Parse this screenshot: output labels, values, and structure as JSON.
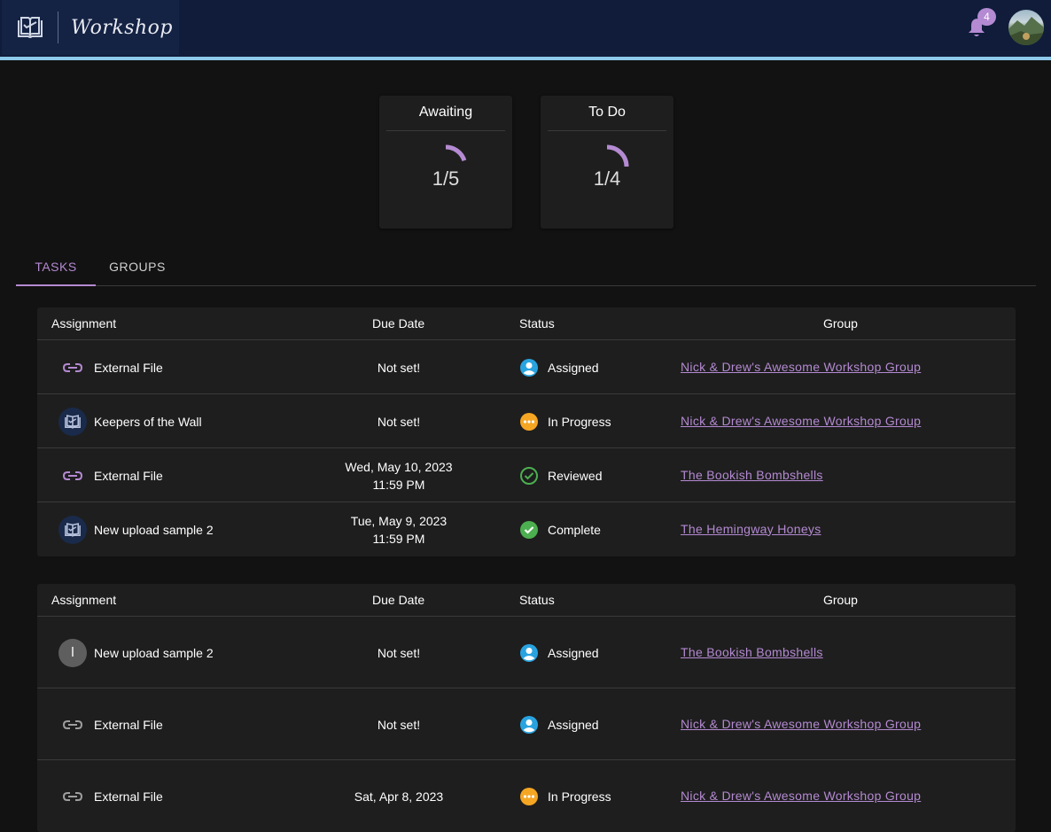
{
  "app": {
    "title": "Workshop"
  },
  "header": {
    "notification_count": "4"
  },
  "stats": [
    {
      "label": "Awaiting",
      "value": "1/5",
      "fraction": 0.2
    },
    {
      "label": "To Do",
      "value": "1/4",
      "fraction": 0.25
    }
  ],
  "tabs": [
    {
      "label": "TASKS",
      "active": true
    },
    {
      "label": "GROUPS",
      "active": false
    }
  ],
  "columns": {
    "assignment": "Assignment",
    "due_date": "Due Date",
    "status": "Status",
    "group": "Group"
  },
  "tables": [
    {
      "rows": [
        {
          "icon": "link-icon",
          "name": "External File",
          "due": [
            "Not set!"
          ],
          "status": "Assigned",
          "status_icon": "assigned-icon",
          "group": "Nick & Drew's Awesome Workshop Group"
        },
        {
          "icon": "book-icon",
          "name": "Keepers of the Wall",
          "due": [
            "Not set!"
          ],
          "status": "In Progress",
          "status_icon": "in-progress-icon",
          "group": "Nick & Drew's Awesome Workshop Group"
        },
        {
          "icon": "link-icon",
          "name": "External File",
          "due": [
            "Wed, May 10, 2023",
            "11:59 PM"
          ],
          "status": "Reviewed",
          "status_icon": "reviewed-icon",
          "group": "The Bookish Bombshells"
        },
        {
          "icon": "book-icon",
          "name": "New upload sample 2",
          "due": [
            "Tue, May 9, 2023",
            "11:59 PM"
          ],
          "status": "Complete",
          "status_icon": "complete-icon",
          "group": "The Hemingway Honeys"
        }
      ]
    },
    {
      "rows": [
        {
          "icon": "letter-avatar-icon",
          "letter": "I",
          "name": "New upload sample 2",
          "due": [
            "Not set!"
          ],
          "status": "Assigned",
          "status_icon": "assigned-icon",
          "group": "The Bookish Bombshells"
        },
        {
          "icon": "link-icon",
          "name": "External File",
          "due": [
            "Not set!"
          ],
          "status": "Assigned",
          "status_icon": "assigned-icon",
          "group": "Nick & Drew's Awesome Workshop Group"
        },
        {
          "icon": "link-icon",
          "name": "External File",
          "due": [
            "Sat, Apr 8, 2023"
          ],
          "status": "In Progress",
          "status_icon": "in-progress-icon",
          "group": "Nick & Drew's Awesome Workshop Group"
        }
      ]
    }
  ],
  "colors": {
    "accent": "#b48ad2",
    "topbar": "#101c3a",
    "topbar_accent": "#8ec9ea",
    "assigned": "#29a3e0",
    "in_progress": "#f5a623",
    "reviewed": "#4caf50",
    "complete": "#4caf50"
  }
}
